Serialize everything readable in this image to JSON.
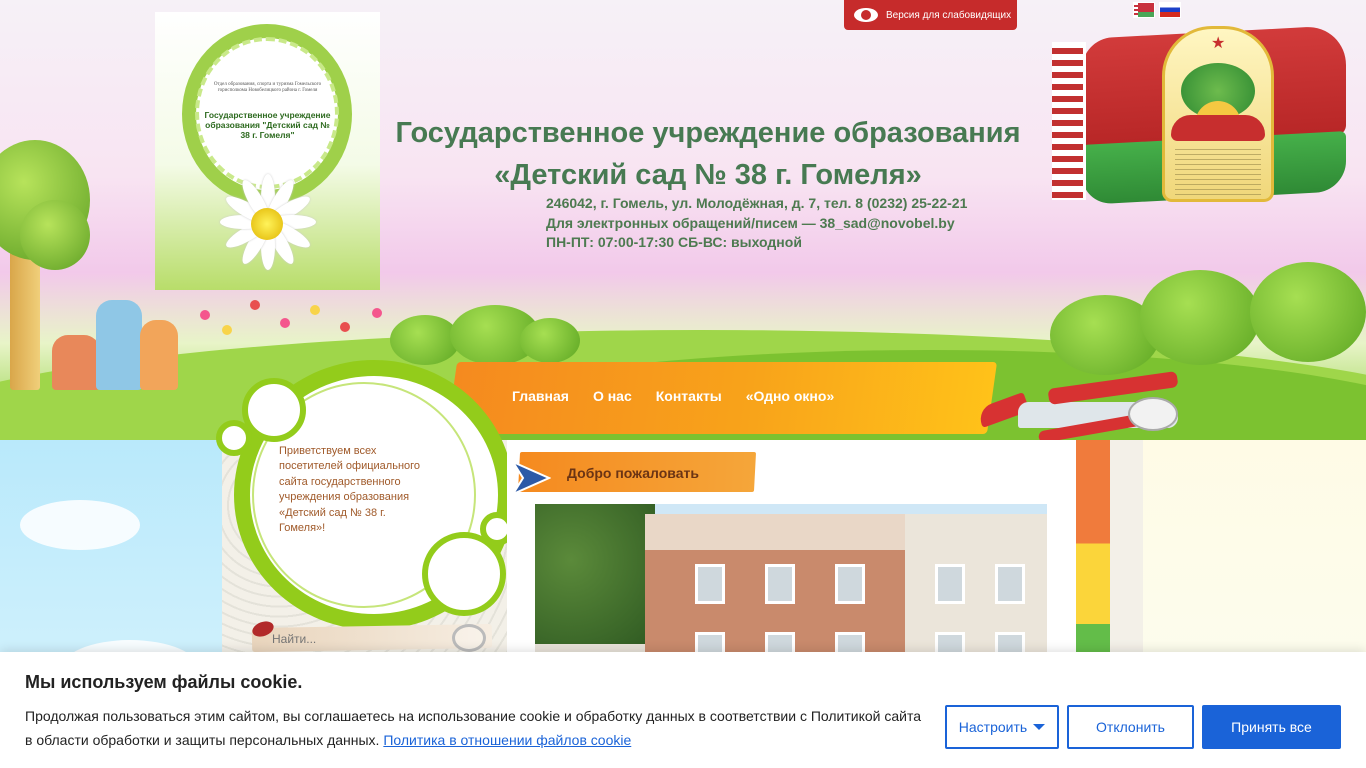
{
  "header": {
    "logo": {
      "small_text": "Отдел образования, спорта и туризма Гомельского горисполкома Новобелицкого района г. Гомеля",
      "title": "Государственное учреждение образования \"Детский сад № 38 г. Гомеля\""
    },
    "title_line1": "Государственное учреждение образования",
    "title_line2": "«Детский сад № 38 г. Гомеля»",
    "address": "246042, г. Гомель, ул. Молодёжная, д. 7, тел. 8 (0232) 25-22-21",
    "email_line": "Для электронных обращений/писем — 38_sad@novobel.by",
    "hours": "ПН-ПТ: 07:00-17:30 СБ-ВС: выходной",
    "low_vision_label": "Версия для слабовидящих",
    "languages": [
      "be",
      "ru"
    ]
  },
  "nav": {
    "items": [
      "Главная",
      "О нас",
      "Контакты",
      "«Одно окно»"
    ]
  },
  "sidebar": {
    "welcome_text": "Приветствуем всех посетителей официального сайта государственного учреждения образования «Детский сад № 38 г. Гомеля»!",
    "search_placeholder": "Найти..."
  },
  "main": {
    "welcome_title": "Добро пожаловать"
  },
  "cookie": {
    "title": "Мы используем файлы cookie.",
    "text": "Продолжая пользоваться этим сайтом, вы соглашаетесь на использование cookie и обработку данных в соответствии с Политикой сайта в области обработки и защиты персональных данных.",
    "policy_link": "Политика в отношении файлов cookie",
    "settings_label": "Настроить",
    "reject_label": "Отклонить",
    "accept_label": "Принять все"
  },
  "colors": {
    "title_green": "#477a52",
    "nav_orange": "#f8a31a",
    "low_vision_red": "#c62b2b",
    "cookie_blue": "#1a63d8"
  }
}
